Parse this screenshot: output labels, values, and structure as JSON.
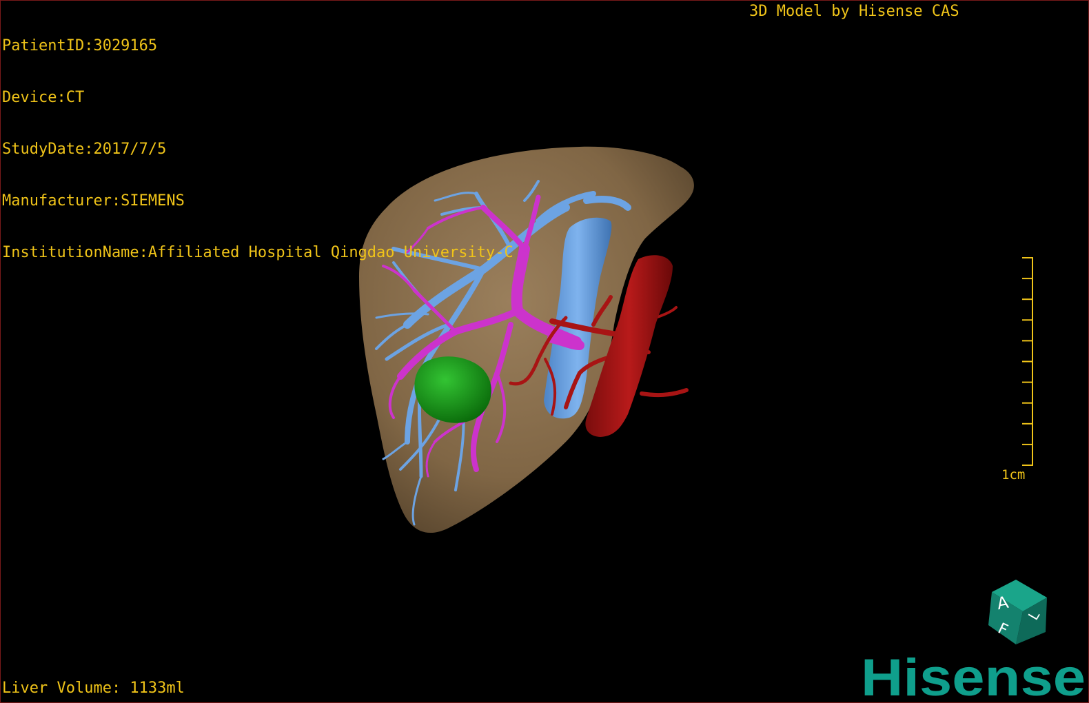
{
  "patient": {
    "id_line": "PatientID:3029165",
    "device_line": "Device:CT",
    "study_date_line": "StudyDate:2017/7/5",
    "manufacturer_line": "Manufacturer:SIEMENS",
    "institution_line": "InstitutionName:Affiliated Hospital Qingdao University-C"
  },
  "credit": "3D Model by Hisense CAS",
  "liver_volume": "Liver Volume: 1133ml",
  "scale": {
    "label": "1cm",
    "ticks": 10
  },
  "orientation_cube": {
    "faces": [
      "A",
      "F",
      "L"
    ]
  },
  "brand": {
    "name": "Hisense",
    "color": "#0f9f8c"
  },
  "colors": {
    "overlay_text": "#f0c419",
    "liver": "#8a6f4e",
    "portal_vein": "#6ca3e3",
    "hepatic_vein": "#cc33cc",
    "artery": "#a81414",
    "tumor": "#1a9a1a"
  },
  "icons": {
    "orientation": "orientation-cube-icon",
    "scale": "scale-bar-icon"
  }
}
